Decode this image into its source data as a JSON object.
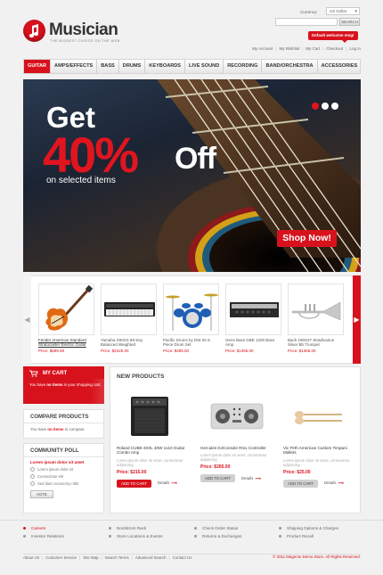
{
  "brand": {
    "name": "Musician",
    "tagline": "THE BIGGEST CHOICE ON THE WEB"
  },
  "header": {
    "currency_label": "Currency:",
    "currency_value": "US Dollar",
    "search_button": "SEARCH",
    "welcome": "Default welcome msg!",
    "links": [
      "My Account",
      "My Wishlist",
      "My Cart",
      "Checkout",
      "Log In"
    ]
  },
  "nav": [
    "GUITAR",
    "AMPS/EFFECTS",
    "BASS",
    "DRUMS",
    "KEYBOARDS",
    "LIVE SOUND",
    "RECORDING",
    "BAND/ORCHESTRA",
    "ACCESSORIES"
  ],
  "banner": {
    "line1": "Get",
    "percent": "40%",
    "off": "Off",
    "sub": "on selected items",
    "cta": "Shop Now!"
  },
  "carousel": [
    {
      "name": "Fender American Standard Stratocaster Electric Guitar",
      "price": "Price: $599.99",
      "icon": "guitar-icon"
    },
    {
      "name": "Yamaha S90XS 88-Key Balanced Weighted",
      "price": "Price: $2425.00",
      "icon": "keyboard-icon"
    },
    {
      "name": "Pacific Drums by DW 25 5-Piece Drum Set",
      "price": "Price: $295.00",
      "icon": "drum-set-icon"
    },
    {
      "name": "Gens Bass GBE 1200 Bass Amp",
      "price": "Price: $1365.00",
      "icon": "bass-amp-icon"
    },
    {
      "name": "Bach 180S37 Stradivarius Silver Bb Trumpet",
      "price": "Price: $1365.00",
      "icon": "trumpet-icon"
    }
  ],
  "cart": {
    "title": "MY CART",
    "text_pre": "You have ",
    "text_bold": "no items",
    "text_post": " in your shopping cart."
  },
  "compare": {
    "title": "COMPARE PRODUCTS",
    "text_pre": "You have ",
    "text_bold": "no items",
    "text_post": " to compare."
  },
  "poll": {
    "title": "COMMUNITY POLL",
    "question": "Lorem ipsum dolor sit amet",
    "options": [
      "Lorem ipsum dolor sit",
      "Consectetur elit",
      "Sed diam nonummy nibh"
    ],
    "vote": "VOTE"
  },
  "new_products": {
    "title": "NEW PRODUCTS",
    "items": [
      {
        "name": "Roland CUBE-40XL 40W 1x10 Guitar Combo Amp",
        "desc": "Lorem ipsum dolor sit amet, consectetur adipiscing",
        "price": "Price: $215.00",
        "cart": "ADD TO CART",
        "details": "Details",
        "icon": "guitar-amp-icon"
      },
      {
        "name": "Hercules DJConsole Rmx Controller",
        "desc": "Lorem ipsum dolor sit amet, consectetur adipiscing",
        "price": "Price: $265.00",
        "cart": "ADD TO CART",
        "details": "Details",
        "icon": "dj-console-icon"
      },
      {
        "name": "Vic Firth American Custom Timpani Mallets",
        "desc": "Lorem ipsum dolor sit amet, consectetur adipiscing",
        "price": "Price: $25.00",
        "cart": "ADD TO CART",
        "details": "Details",
        "icon": "mallets-icon"
      }
    ]
  },
  "footer": {
    "col1": [
      "Careers",
      "Investor Relations"
    ],
    "col2": [
      "Nordstrom Rack",
      "Store Locations & Events"
    ],
    "col3": [
      "Check Order Status",
      "Returns & Exchanges"
    ],
    "col4": [
      "Shipping Options & Charges",
      "Product Recall"
    ],
    "bottom_links": [
      "About Us",
      "Customer Service",
      "Site Map",
      "Search Terms",
      "Advanced Search",
      "Contact Us"
    ],
    "copyright": "© 2011 Magento Demo Store. All Rights Reserved."
  },
  "colors": {
    "accent": "#d8121d",
    "background": "#f1f1f1"
  }
}
